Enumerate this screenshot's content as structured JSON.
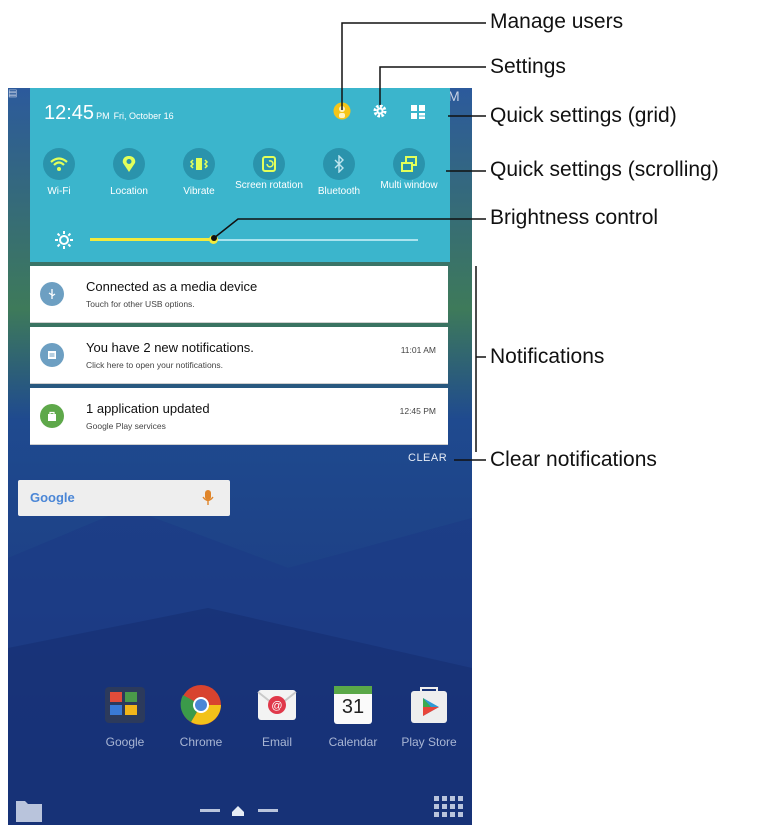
{
  "status": {
    "time": "12:45",
    "ampm": "PM",
    "date": "Fri, October 16"
  },
  "quick_settings": [
    {
      "label": "Wi-Fi",
      "icon": "wifi-icon"
    },
    {
      "label": "Location",
      "icon": "location-icon"
    },
    {
      "label": "Vibrate",
      "icon": "vibrate-icon"
    },
    {
      "label": "Screen rotation",
      "icon": "screen-rotation-icon"
    },
    {
      "label": "Bluetooth",
      "icon": "bluetooth-icon"
    },
    {
      "label": "Multi window",
      "icon": "multi-window-icon"
    }
  ],
  "brightness": {
    "level": 0.38
  },
  "notifications": [
    {
      "title": "Connected as a media device",
      "subtitle": "Touch for other USB options.",
      "time": "",
      "icon": "usb-icon",
      "color": "#6d9fc2"
    },
    {
      "title": "You have 2 new notifications.",
      "subtitle": "Click here to open your notifications.",
      "time": "11:01 AM",
      "icon": "notification-icon",
      "color": "#6d9fc2"
    },
    {
      "title": "1 application updated",
      "subtitle": "Google Play services",
      "time": "12:45 PM",
      "icon": "play-store-bag-icon",
      "color": "#5ea84a"
    }
  ],
  "clear_label": "CLEAR",
  "search_widget": {
    "logo": "Google"
  },
  "apps": [
    {
      "label": "Google",
      "icon": "google-folder-icon"
    },
    {
      "label": "Chrome",
      "icon": "chrome-icon"
    },
    {
      "label": "Email",
      "icon": "email-icon"
    },
    {
      "label": "Calendar",
      "icon": "calendar-icon",
      "badge": "31"
    },
    {
      "label": "Play Store",
      "icon": "play-store-icon"
    }
  ],
  "callouts": {
    "manage_users": "Manage users",
    "settings": "Settings",
    "qs_grid": "Quick settings (grid)",
    "qs_scrolling": "Quick settings (scrolling)",
    "brightness": "Brightness control",
    "notifications": "Notifications",
    "clear": "Clear notifications"
  },
  "colors": {
    "shade": "#3bb5cc",
    "brightness_accent": "#f2ea3c",
    "wallpaper": "#1f3f8f"
  }
}
